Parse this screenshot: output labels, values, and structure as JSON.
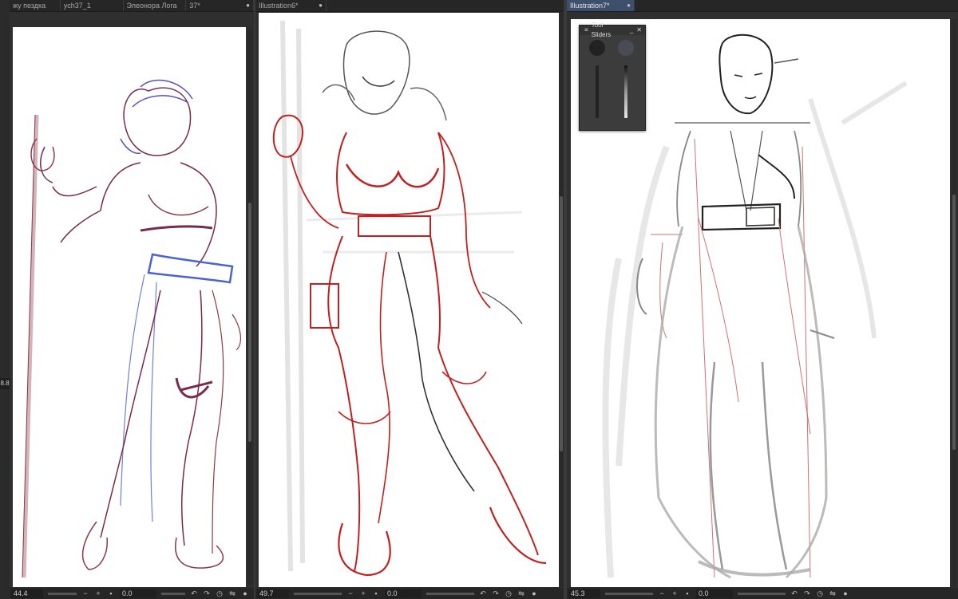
{
  "panes": [
    {
      "tabs": [
        {
          "label": "жу пездка"
        },
        {
          "label": "усh37_1"
        },
        {
          "label": "Элеонора Лога"
        },
        {
          "label": "37*",
          "modified_dot": "●"
        }
      ],
      "zoom": "44.4",
      "angle": "0.0"
    },
    {
      "tabs": [
        {
          "label": "Illustration6*",
          "modified_dot": "●"
        }
      ],
      "zoom": "49.7",
      "angle": "0.0"
    },
    {
      "tabs": [
        {
          "label": "Illustration7*",
          "modified_dot": "●",
          "active": true
        }
      ],
      "zoom": "45.3",
      "angle": "0.0"
    }
  ],
  "side_value": "8.8",
  "tool_sliders": {
    "title": "Tool Sliders",
    "minimize": "_",
    "close": "✕"
  },
  "statusbar_icons": [
    "minus-icon",
    "plus-icon",
    "fit-icon",
    "rotate-left-icon",
    "rotate-right-icon",
    "reset-icon",
    "flip-icon",
    "stop-icon"
  ],
  "colors": {
    "active_tab": "#3d4f6a",
    "sketch_red": "#c22020",
    "sketch_blue": "#4a63d0",
    "sketch_purple": "#7a2a4a"
  }
}
